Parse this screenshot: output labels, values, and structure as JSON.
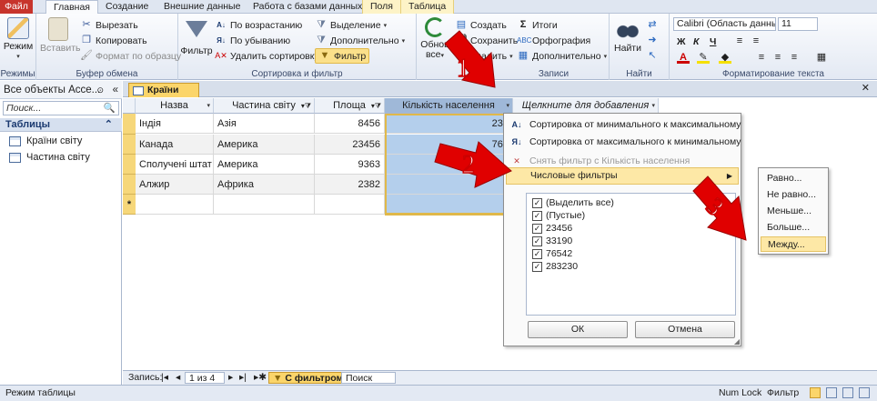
{
  "tabs": [
    "Файл",
    "Главная",
    "Создание",
    "Внешние данные",
    "Работа с базами данных",
    "Поля",
    "Таблица"
  ],
  "ribbon": {
    "groups": {
      "views": "Режимы",
      "clipboard": "Буфер обмена",
      "sort": "Сортировка и фильтр",
      "records": "Записи",
      "find": "Найти",
      "text": "Форматирование текста"
    },
    "view_btn": "Режим",
    "paste_btn": "Вставить",
    "cut": "Вырезать",
    "copy": "Копировать",
    "format_painter": "Формат по образцу",
    "filter_btn": "Фильтр",
    "asc": "По возрастанию",
    "desc": "По убыванию",
    "clear_sort": "Удалить сортировку",
    "selection": "Выделение",
    "advanced": "Дополнительно",
    "toggle_filter": "Фильтр",
    "refresh_line1": "Обнов",
    "refresh_line2": "все",
    "new": "Создать",
    "save": "Сохранить",
    "delete": "Удалить",
    "totals": "Итоги",
    "spelling": "Орфография",
    "more": "Дополнительно",
    "find_btn": "Найти",
    "font_name": "Calibri (Область данны",
    "font_size": "11",
    "bold": "Ж",
    "italic": "К",
    "underline": "Ч"
  },
  "nav": {
    "header": "Все объекты Acce...",
    "search_placeholder": "Поиск...",
    "section": "Таблицы",
    "items": [
      "Країни світу",
      "Частина світу"
    ]
  },
  "document": {
    "tab": "Країни світу"
  },
  "grid": {
    "columns": [
      "Назва",
      "Частина світу",
      "Площа",
      "Кількість населення",
      "Щелкните для добавления"
    ],
    "rows": [
      {
        "name": "Індія",
        "region": "Азія",
        "area": "8456",
        "pop": "234"
      },
      {
        "name": "Канада",
        "region": "Америка",
        "area": "23456",
        "pop": "765"
      },
      {
        "name": "Сполучені штат",
        "region": "Америка",
        "area": "9363",
        "pop": ""
      },
      {
        "name": "Алжир",
        "region": "Африка",
        "area": "2382",
        "pop": ""
      }
    ],
    "new_row_marker": "*"
  },
  "menu": {
    "sort_asc": "Сортировка от минимального к максимальному",
    "sort_desc": "Сортировка от максимального к минимальному",
    "clear_filter": "Снять фильтр с Кількість населення",
    "number_filters": "Числовые фильтры",
    "checks": [
      "(Выделить все)",
      "(Пустые)",
      "23456",
      "33190",
      "76542",
      "283230"
    ],
    "ok": "ОК",
    "cancel": "Отмена"
  },
  "submenu": [
    "Равно...",
    "Не равно...",
    "Меньше...",
    "Больше...",
    "Между..."
  ],
  "record_nav": {
    "label": "Запись:",
    "position": "1 из 4",
    "filtered": "С фильтром",
    "search": "Поиск"
  },
  "status": {
    "mode": "Режим таблицы",
    "numlock": "Num Lock",
    "filter": "Фильтр"
  },
  "annotations": [
    "1",
    "2",
    "3"
  ],
  "colors": {
    "file_tab": "#c7342c",
    "accent": "#fbd56a",
    "highlight": "#b4cfec",
    "arrow": "#e00000"
  }
}
